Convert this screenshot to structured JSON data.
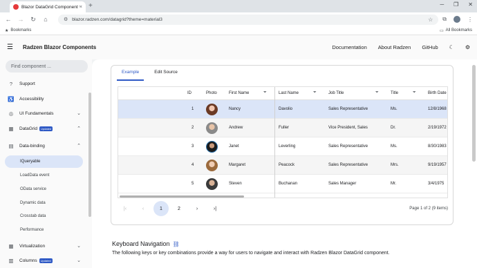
{
  "browser": {
    "tab_title": "Blazor DataGrid Component w",
    "tab_close": "×",
    "new_tab": "+",
    "url": "blazor.radzen.com/datagrid?theme=material3",
    "bookmarks_label": "Bookmarks",
    "all_bookmarks_label": "All Bookmarks",
    "win_min": "─",
    "win_max": "❐",
    "win_close": "✕"
  },
  "header": {
    "brand": "Radzen Blazor Components",
    "links": [
      "Documentation",
      "About Radzen",
      "GitHub"
    ]
  },
  "sidebar": {
    "search_placeholder": "Find component ...",
    "items": [
      {
        "label": "Support",
        "icon": "help-icon"
      },
      {
        "label": "Accessibility",
        "icon": "accessibility-icon"
      },
      {
        "label": "UI Fundamentals",
        "icon": "palette-icon"
      },
      {
        "label": "DataGrid",
        "icon": "grid-icon",
        "badge": "Updated"
      },
      {
        "label": "Data-binding",
        "icon": "table-icon"
      },
      {
        "label": "Virtualization",
        "icon": "grid-small-icon"
      },
      {
        "label": "Columns",
        "icon": "columns-icon",
        "badge": "Updated"
      }
    ],
    "sub_items": [
      "IQueryable",
      "LoadData event",
      "OData service",
      "Dynamic data",
      "Crosstab data",
      "Performance"
    ]
  },
  "card": {
    "tabs": [
      "Example",
      "Edit Source"
    ],
    "columns": [
      "ID",
      "Photo",
      "First Name",
      "Last Name",
      "Job Title",
      "Title",
      "Birth Date"
    ],
    "rows": [
      {
        "id": "1",
        "first": "Nancy",
        "last": "Davolio",
        "job": "Sales Representative",
        "title": "Ms.",
        "birth": "12/8/1968"
      },
      {
        "id": "2",
        "first": "Andrew",
        "last": "Fuller",
        "job": "Vice President, Sales",
        "title": "Dr.",
        "birth": "2/19/1972"
      },
      {
        "id": "3",
        "first": "Janet",
        "last": "Leverling",
        "job": "Sales Representative",
        "title": "Ms.",
        "birth": "8/30/1983"
      },
      {
        "id": "4",
        "first": "Margaret",
        "last": "Peacock",
        "job": "Sales Representative",
        "title": "Mrs.",
        "birth": "9/19/1957"
      },
      {
        "id": "5",
        "first": "Steven",
        "last": "Buchanan",
        "job": "Sales Manager",
        "title": "Mr.",
        "birth": "3/4/1975"
      }
    ],
    "pager": {
      "pages": [
        "1",
        "2"
      ],
      "info": "Page 1 of 2 (9 items)"
    }
  },
  "keyboard": {
    "title": "Keyboard Navigation",
    "text": "The following keys or key combinations provide a way for users to navigate and interact with Radzen Blazor DataGrid component."
  }
}
